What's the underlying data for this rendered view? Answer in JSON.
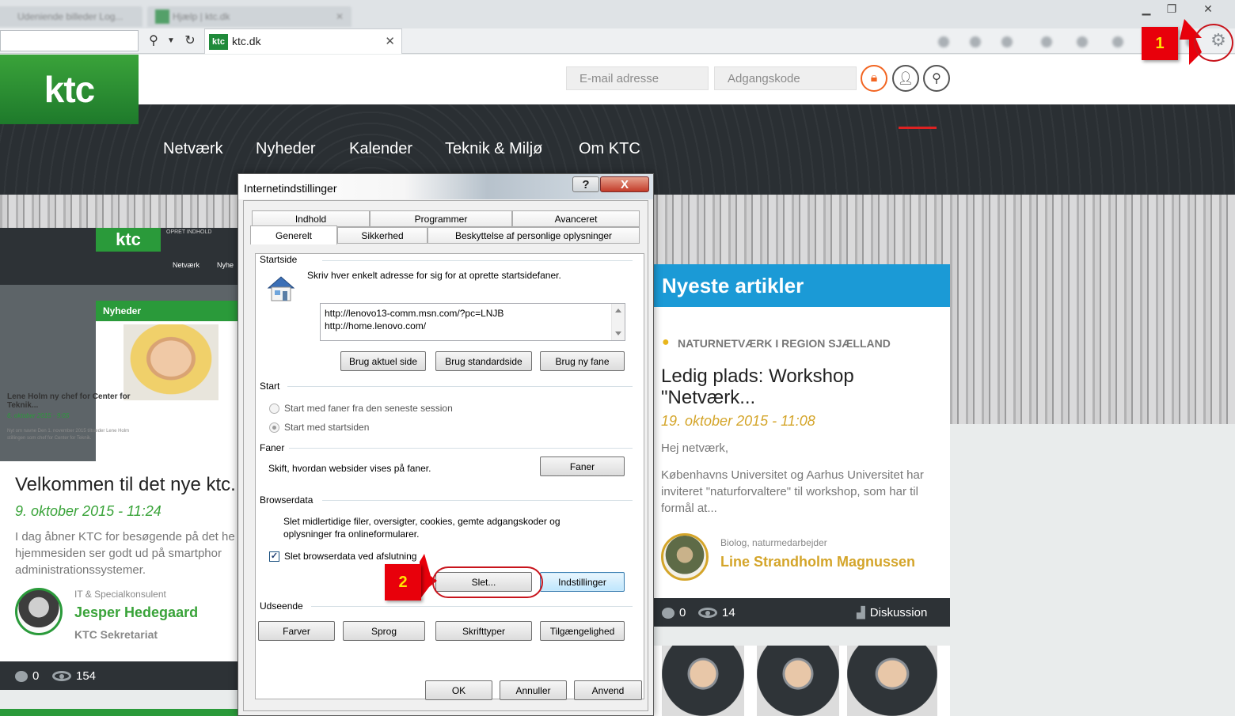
{
  "browser": {
    "blurred_tab_1": "Udeniende billeder Log...",
    "blurred_tab_2": "Hjælp | ktc.dk",
    "active_tab": {
      "favicon_text": "ktc",
      "title": "ktc.dk"
    }
  },
  "site": {
    "logo": "ktc",
    "login": {
      "email_placeholder": "E-mail adresse",
      "password_placeholder": "Adgangskode"
    },
    "nav": [
      "Netværk",
      "Nyheder",
      "Kalender",
      "Teknik & Miljø",
      "Om KTC"
    ]
  },
  "left_card": {
    "mini": {
      "logo": "ktc",
      "opret": "OPRET INDHOLD",
      "nav1": "Netværk",
      "nav2": "Nyhe",
      "section": "Nyheder",
      "article_title": "Lene Holm ny chef for Center for Teknik...",
      "article_date": "6. oktober 2015 - 9:05",
      "article_text": "Nyt om navne Den 1. november 2015 tiltræder Lene Holm stillingen som chef for Center for Teknik."
    },
    "title": "Velkommen til det nye ktc.",
    "date": "9. oktober 2015 - 11:24",
    "excerpt_lines": [
      "I dag åbner KTC for besøgende på det he",
      "hjemmesiden ser godt ud på smartphor",
      "administrationssystemer."
    ],
    "author_role": "IT & Specialkonsulent",
    "author_name": "Jesper Hedegaard",
    "author_org": "KTC Sekretariat",
    "comments": "0",
    "views": "154"
  },
  "right_card": {
    "heading": "Nyeste artikler",
    "category": "NATURNETVÆRK I REGION SJÆLLAND",
    "title": "Ledig plads: Workshop \"Netværk...",
    "date": "19. oktober 2015 - 11:08",
    "p1": "Hej netværk,",
    "p2": "Københavns Universitet og Aarhus Universitet har inviteret \"naturforvaltere\" til workshop, som har til formål at...",
    "author_role": "Biolog, naturmedarbejder",
    "author_name": "Line Strandholm Magnussen",
    "comments": "0",
    "views": "14",
    "discussion": "Diskussion"
  },
  "dialog": {
    "title": "Internetindstillinger",
    "help": "?",
    "close": "X",
    "tabs_back": [
      "Indhold",
      "Programmer",
      "Avanceret"
    ],
    "tabs_front": [
      "Generelt",
      "Sikkerhed",
      "Beskyttelse af personlige oplysninger"
    ],
    "startside": {
      "label": "Startside",
      "hint": "Skriv hver enkelt adresse for sig for at oprette startsidefaner.",
      "urls": [
        "http://lenovo13-comm.msn.com/?pc=LNJB",
        "http://home.lenovo.com/"
      ],
      "btn_current": "Brug aktuel side",
      "btn_default": "Brug standardside",
      "btn_newtab": "Brug ny fane"
    },
    "start": {
      "label": "Start",
      "opt1": "Start med faner fra den seneste session",
      "opt2": "Start med startsiden"
    },
    "faner": {
      "label": "Faner",
      "text": "Skift, hvordan websider vises på faner.",
      "btn": "Faner"
    },
    "browserdata": {
      "label": "Browserdata",
      "text1": "Slet midlertidige filer, oversigter, cookies, gemte adgangskoder og",
      "text2": "oplysninger fra onlineformularer.",
      "checkbox": "Slet browserdata ved afslutning",
      "btn_delete": "Slet...",
      "btn_settings": "Indstillinger"
    },
    "udseende": {
      "label": "Udseende",
      "btn_colors": "Farver",
      "btn_languages": "Sprog",
      "btn_fonts": "Skrifttyper",
      "btn_access": "Tilgængelighed"
    },
    "ok": "OK",
    "cancel": "Annuller",
    "apply": "Anvend"
  },
  "annotations": {
    "callout1": "1",
    "callout2": "2"
  },
  "colors": {
    "ktc_green": "#2a9a3a",
    "accent_blue": "#1b9ad6",
    "gold": "#d4a52a",
    "callout_red": "#e8000b",
    "callout_yellow": "#ffe400"
  }
}
